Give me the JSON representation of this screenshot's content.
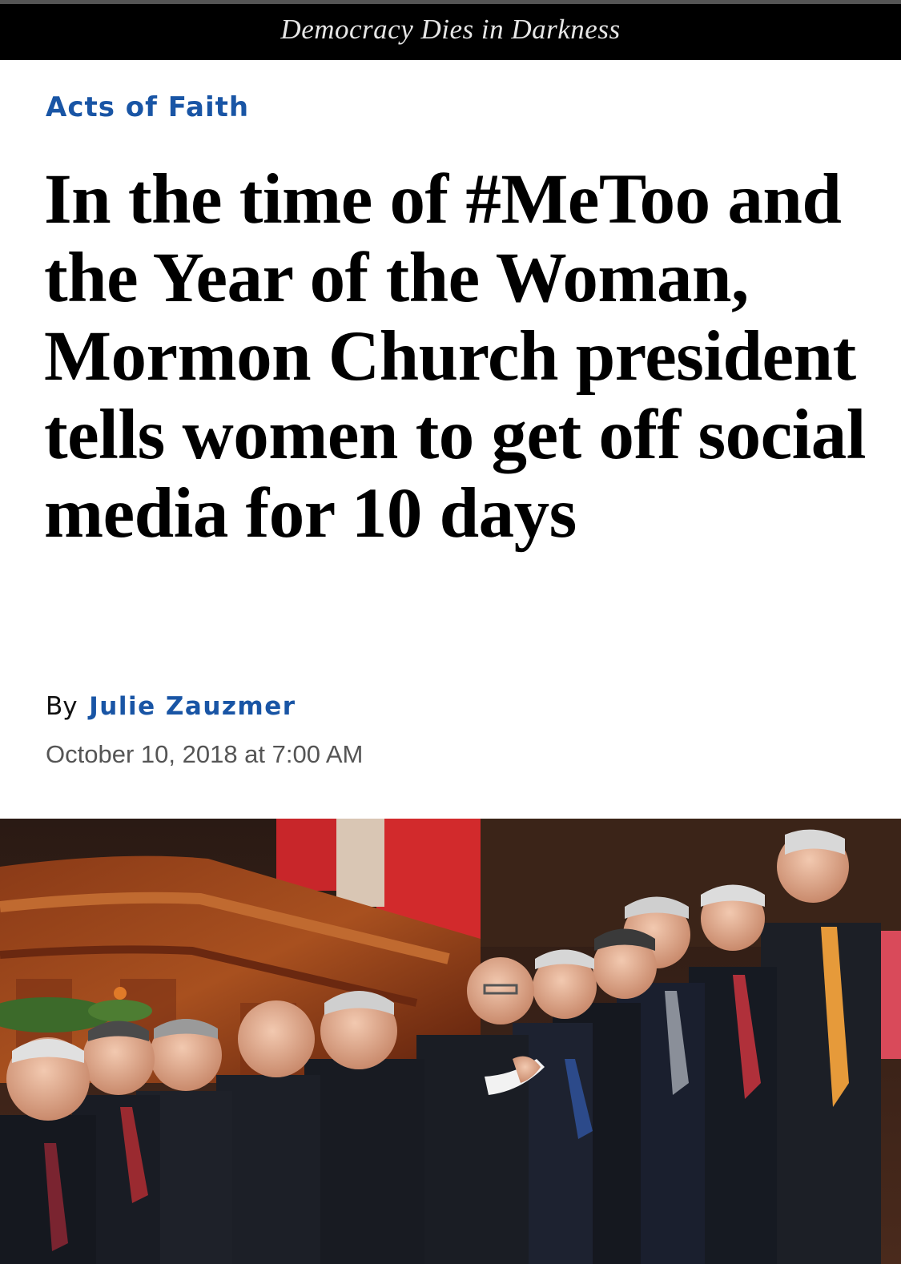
{
  "header": {
    "tagline": "Democracy Dies in Darkness"
  },
  "article": {
    "section": "Acts of Faith",
    "headline": "In the time of #MeToo and the Year of the Woman, Mormon Church president tells women to get off social media for 10 days",
    "byline_prefix": "By",
    "author": "Julie Zauzmer",
    "date": "October 10, 2018 at 7:00 AM"
  },
  "colors": {
    "accent": "#1955a5",
    "topbar": "#000000",
    "headline": "#000000",
    "dateline": "#555555"
  },
  "photo": {
    "icon": "article-photo"
  }
}
